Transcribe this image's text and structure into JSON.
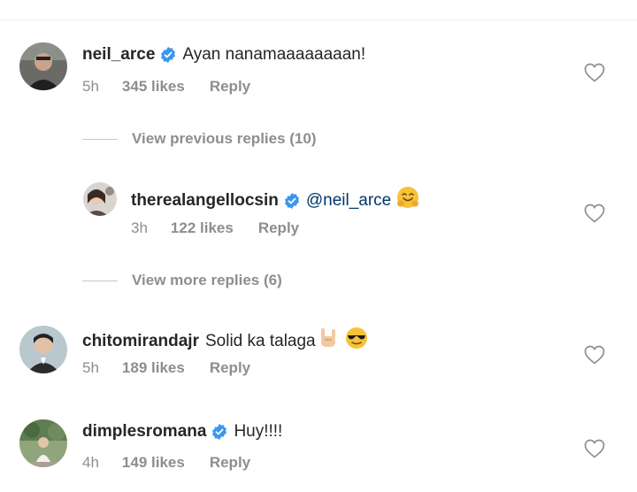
{
  "comments": [
    {
      "username": "neil_arce",
      "verified": true,
      "text": "Ayan nanamaaaaaaaan!",
      "time": "5h",
      "likes": "345 likes",
      "reply": "Reply"
    },
    {
      "username": "therealangellocsin",
      "verified": true,
      "mention": "@neil_arce",
      "emoji": "hugging-face-emoji",
      "time": "3h",
      "likes": "122 likes",
      "reply": "Reply"
    },
    {
      "username": "chitomirandajr",
      "verified": false,
      "text": "Solid ka talaga",
      "emoji": "sign-of-horns-emoji, sunglasses-emoji",
      "time": "5h",
      "likes": "189 likes",
      "reply": "Reply"
    },
    {
      "username": "dimplesromana",
      "verified": true,
      "text": "Huy!!!!",
      "time": "4h",
      "likes": "149 likes",
      "reply": "Reply"
    }
  ],
  "view_previous_replies": "View previous replies (10)",
  "view_more_replies": "View more replies (6)",
  "colors": {
    "username": "#262626",
    "meta": "#8e8e8e",
    "verified": "#3897f0",
    "mention": "#00376b"
  }
}
